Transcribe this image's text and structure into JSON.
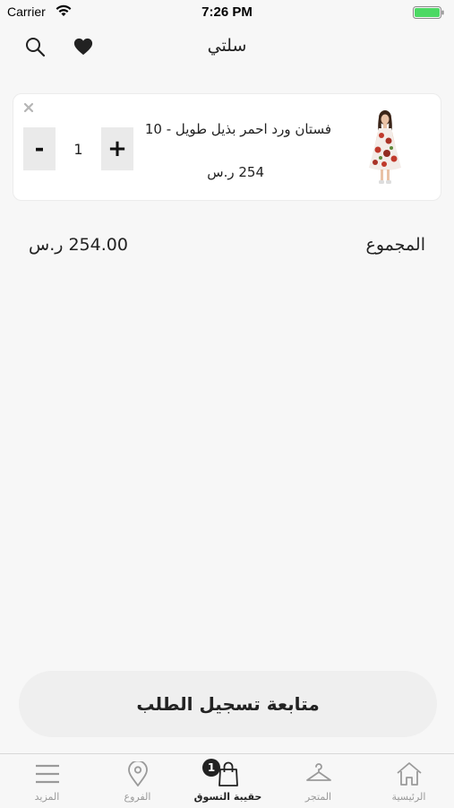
{
  "status_bar": {
    "carrier": "Carrier",
    "time": "7:26 PM",
    "battery_color": "#4cd964"
  },
  "nav": {
    "title": "سلتي",
    "left_icons": [
      "search-icon",
      "heart-icon"
    ]
  },
  "cart": {
    "items": [
      {
        "name": "فستان ورد احمر بذيل طويل - 10",
        "price": "254 ر.س",
        "quantity": "1",
        "minus_label": "-",
        "plus_label": "+",
        "image_icon": "girl-dress-product-image"
      }
    ]
  },
  "summary": {
    "total_label": "المجموع",
    "total_amount": "254.00 ر.س"
  },
  "checkout": {
    "label": "متابعة تسجيل الطلب"
  },
  "tab_bar": {
    "active_color": "#222222",
    "inactive_color": "#9a9a9a",
    "tabs": [
      {
        "label": "المزيد",
        "icon": "menu-icon"
      },
      {
        "label": "الفروع",
        "icon": "location-pin-icon"
      },
      {
        "label": "حقيبة التسوق",
        "icon": "shopping-bag-icon",
        "badge": "1",
        "active": true
      },
      {
        "label": "المتجر",
        "icon": "hanger-icon"
      },
      {
        "label": "الرئيسية",
        "icon": "home-icon"
      }
    ]
  }
}
